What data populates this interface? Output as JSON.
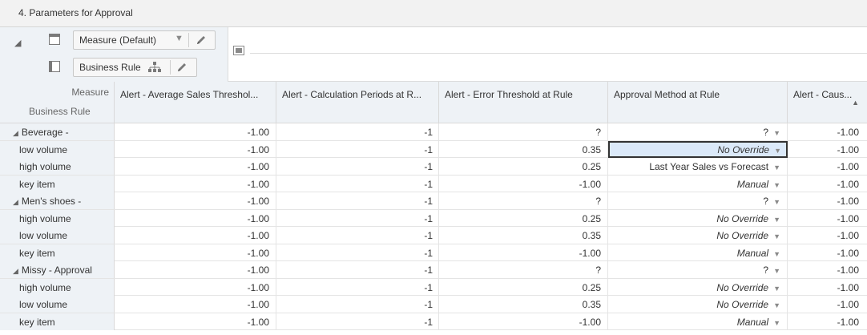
{
  "panel": {
    "title": "4. Parameters for Approval"
  },
  "pivot": {
    "column_chip_label": "Measure (Default)",
    "row_chip_label": "Business Rule",
    "icons": [
      "collapse-triangle-icon",
      "column-layout-icon",
      "row-layout-icon",
      "dropdown-arrow-icon",
      "pencil-icon",
      "hierarchy-icon",
      "pivot-toggle-icon"
    ]
  },
  "grid": {
    "corner": {
      "measure_label": "Measure",
      "business_rule_label": "Business Rule"
    },
    "columns": [
      "Alert - Average Sales Threshol...",
      "Alert - Calculation Periods at R...",
      "Alert - Error Threshold at Rule",
      "Approval Method at Rule",
      "Alert - Caus..."
    ],
    "rows": [
      {
        "label": "Beverage -",
        "group": true,
        "c1": "-1.00",
        "c2": "-1",
        "c3": "?",
        "c4": "?",
        "c4_italic": false,
        "c5": "-1.00"
      },
      {
        "label": "low volume",
        "group": false,
        "c1": "-1.00",
        "c2": "-1",
        "c3": "0.35",
        "c4": "No Override",
        "c4_italic": true,
        "c5": "-1.00",
        "selected": true
      },
      {
        "label": "high volume",
        "group": false,
        "c1": "-1.00",
        "c2": "-1",
        "c3": "0.25",
        "c4": "Last Year Sales vs Forecast",
        "c4_italic": false,
        "c5": "-1.00"
      },
      {
        "label": "key item",
        "group": false,
        "c1": "-1.00",
        "c2": "-1",
        "c3": "-1.00",
        "c4": "Manual",
        "c4_italic": true,
        "c5": "-1.00"
      },
      {
        "label": "Men's shoes -",
        "group": true,
        "c1": "-1.00",
        "c2": "-1",
        "c3": "?",
        "c4": "?",
        "c4_italic": false,
        "c5": "-1.00"
      },
      {
        "label": "high volume",
        "group": false,
        "c1": "-1.00",
        "c2": "-1",
        "c3": "0.25",
        "c4": "No Override",
        "c4_italic": true,
        "c5": "-1.00"
      },
      {
        "label": "low volume",
        "group": false,
        "c1": "-1.00",
        "c2": "-1",
        "c3": "0.35",
        "c4": "No Override",
        "c4_italic": true,
        "c5": "-1.00"
      },
      {
        "label": "key item",
        "group": false,
        "c1": "-1.00",
        "c2": "-1",
        "c3": "-1.00",
        "c4": "Manual",
        "c4_italic": true,
        "c5": "-1.00"
      },
      {
        "label": "Missy - Approval",
        "group": true,
        "c1": "-1.00",
        "c2": "-1",
        "c3": "?",
        "c4": "?",
        "c4_italic": false,
        "c5": "-1.00"
      },
      {
        "label": "high volume",
        "group": false,
        "c1": "-1.00",
        "c2": "-1",
        "c3": "0.25",
        "c4": "No Override",
        "c4_italic": true,
        "c5": "-1.00"
      },
      {
        "label": "low volume",
        "group": false,
        "c1": "-1.00",
        "c2": "-1",
        "c3": "0.35",
        "c4": "No Override",
        "c4_italic": true,
        "c5": "-1.00"
      },
      {
        "label": "key item",
        "group": false,
        "c1": "-1.00",
        "c2": "-1",
        "c3": "-1.00",
        "c4": "Manual",
        "c4_italic": true,
        "c5": "-1.00"
      }
    ]
  },
  "colors": {
    "header_bg": "#eef2f6",
    "selection_bg": "#dbe9f9",
    "title_bg": "#f2f2f2"
  }
}
